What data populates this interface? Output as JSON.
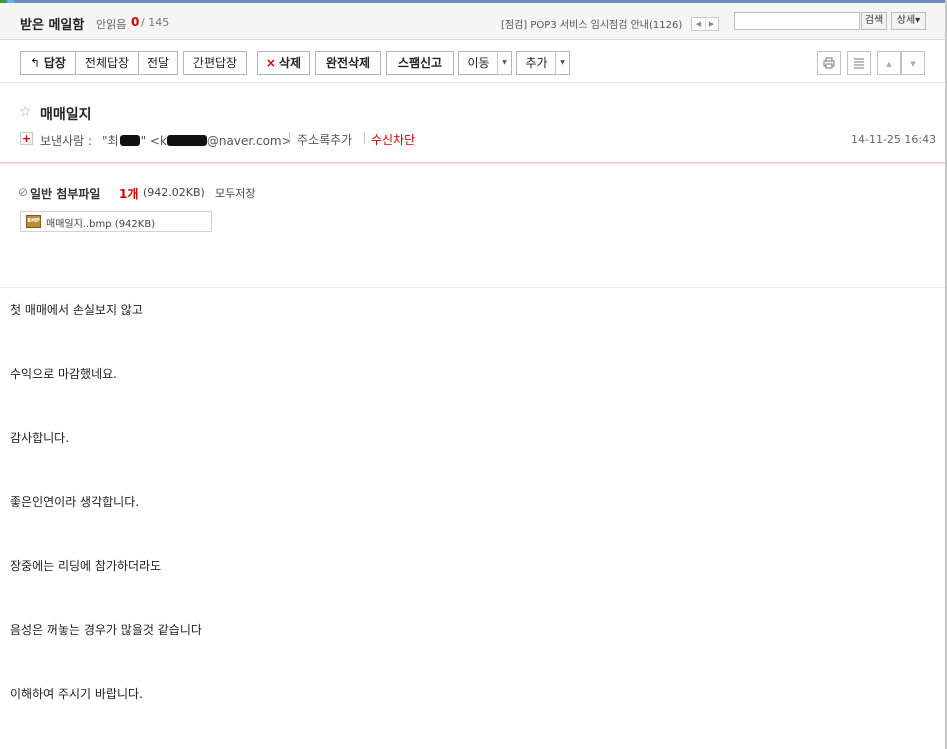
{
  "header": {
    "mailbox_title": "받은 메일함",
    "unread_label": "안읽음",
    "unread_count": "0",
    "total_count": "/ 145",
    "notice": "[점검] POP3 서비스 임시점검 안내(1126)",
    "pager_prev": "◀",
    "pager_next": "▶",
    "search_value": "",
    "search_button": "검색",
    "detail_button": "상세▾"
  },
  "toolbar": {
    "reply": "답장",
    "reply_all": "전체답장",
    "forward": "전달",
    "quick_reply": "간편답장",
    "delete": "삭제",
    "delete_permanent": "완전삭제",
    "report_spam": "스팸신고",
    "move": "이동",
    "more": "추가"
  },
  "message": {
    "subject": "매매일지",
    "sender_label": "보낸사람 :",
    "sender_name_prefix": "\"최",
    "sender_name_suffix": "\" <k",
    "sender_email_domain": "@naver.com>",
    "add_contact": "주소록추가",
    "block_sender": "수신차단",
    "date": "14-11-25 16:43"
  },
  "attachments": {
    "title": "일반 첨부파일",
    "count": "1개",
    "total_size": "(942.02KB)",
    "save_all": "모두저장",
    "files": [
      {
        "name": "매매일지..bmp",
        "size": "(942KB)",
        "icon_label": "BMP"
      }
    ]
  },
  "body": {
    "lines": [
      "첫 매매에서  손실보지 않고",
      "수익으로 마감했네요.",
      "감사합니다.",
      "좋은인연이라 생각합니다.",
      "장중에는  리딩에  참가하더라도",
      "음성은  꺼놓는 경우가 많을것 같습니다",
      "이해하여 주시기 바랍니다."
    ]
  },
  "colors": {
    "accent_red": "#d40000",
    "header_bg": "#f5f5f5",
    "border": "#b5b5b5"
  }
}
